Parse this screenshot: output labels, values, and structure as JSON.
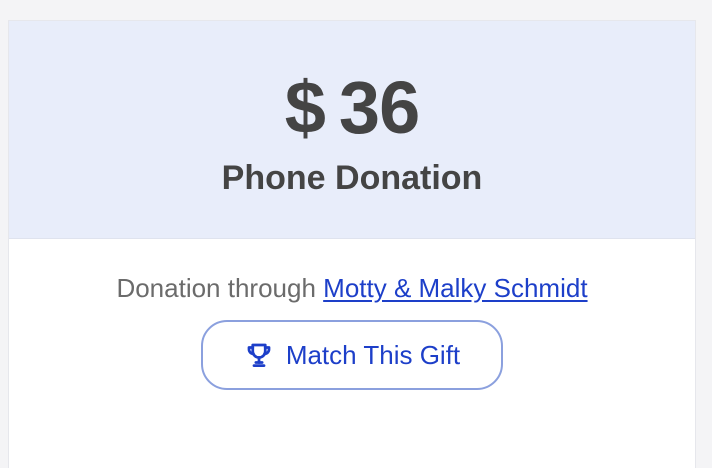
{
  "donation": {
    "currency_symbol": "$",
    "amount": "36",
    "type": "Phone Donation",
    "through_prefix": "Donation through",
    "donor_name": "Motty & Malky Schmidt"
  },
  "actions": {
    "match_label": "Match This Gift",
    "match_icon": "trophy-icon"
  },
  "colors": {
    "header_background": "#e8edfa",
    "accent": "#1d3fc9",
    "button_border": "#8ba0de",
    "text_dark": "#444444",
    "text_muted": "#6b6b6b"
  }
}
